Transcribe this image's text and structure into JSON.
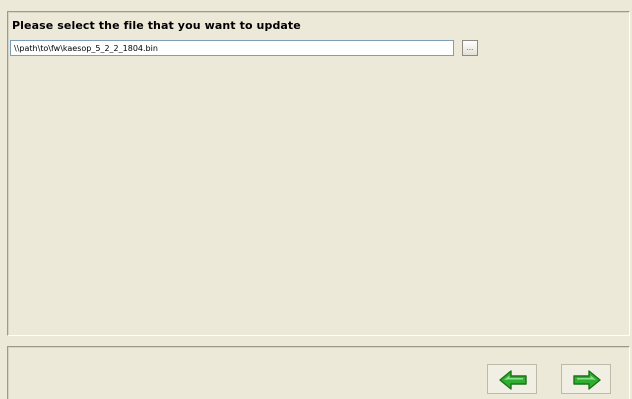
{
  "page": {
    "title": "Please select the file that you want to update"
  },
  "file_selector": {
    "path_value": "\\\\path\\to\\fw\\kaesop_5_2_2_1804.bin",
    "browse_label": "..."
  },
  "navigation": {
    "back_icon": "arrow-left-icon",
    "next_icon": "arrow-right-icon",
    "arrow_color": "#2fae2f",
    "arrow_border": "#197319"
  }
}
